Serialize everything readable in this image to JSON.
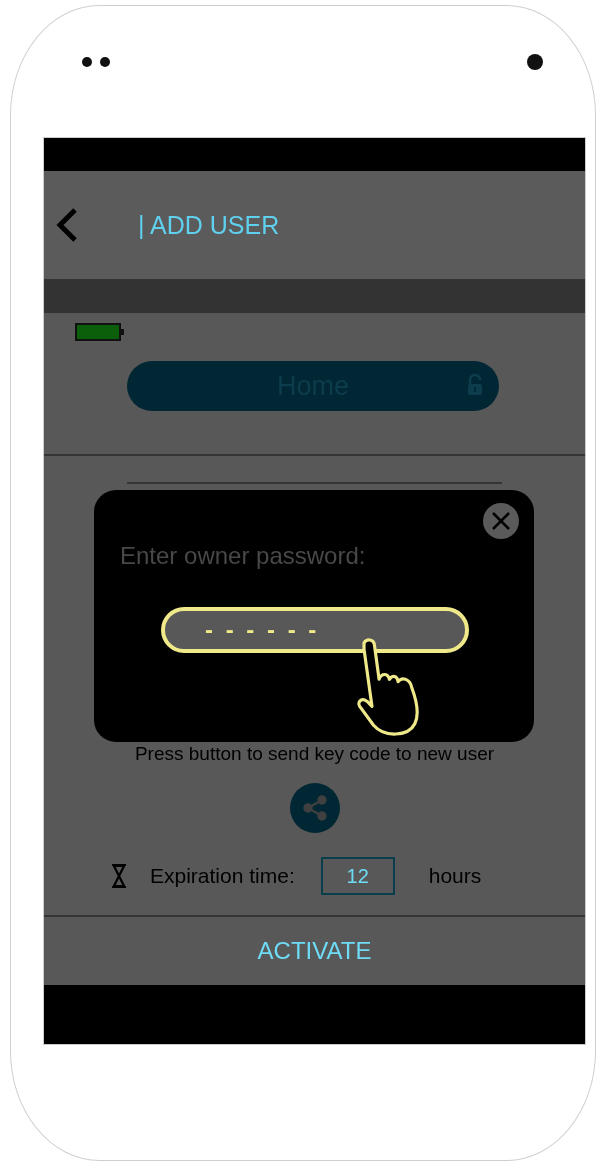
{
  "header": {
    "title": "| ADD USER"
  },
  "device": {
    "name": "Home"
  },
  "instruction": "Press button to send key code to new user",
  "expiration": {
    "label": "Expiration time:",
    "value": "12",
    "unit": "hours"
  },
  "footer": {
    "button": "ACTIVATE"
  },
  "dialog": {
    "label": "Enter owner password:",
    "password_field": {
      "placeholder": "- - - - - -"
    }
  }
}
